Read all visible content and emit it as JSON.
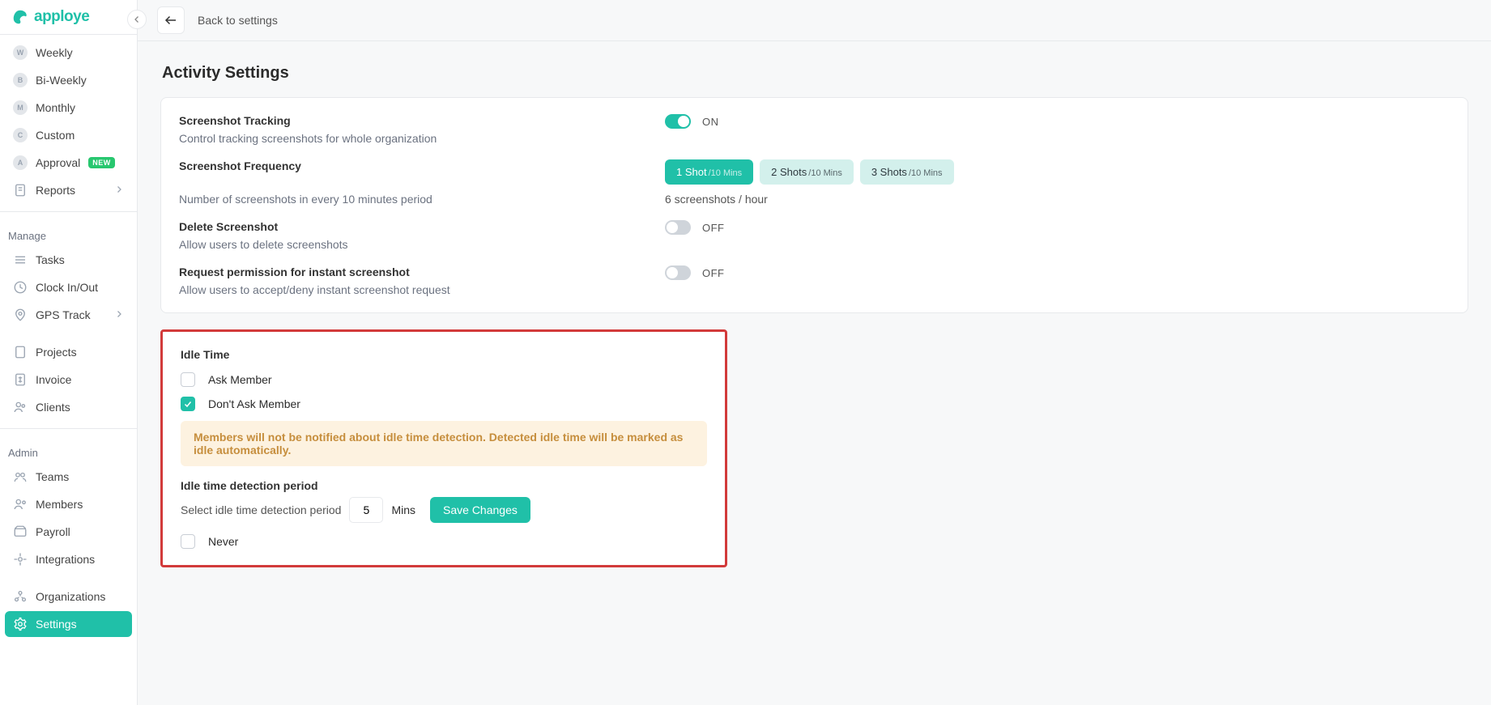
{
  "brand": {
    "name": "apploye"
  },
  "topbar": {
    "back_label": "Back to settings"
  },
  "sidebar": {
    "section_manage": "Manage",
    "section_admin": "Admin",
    "items_top": [
      {
        "letter": "W",
        "label": "Weekly"
      },
      {
        "letter": "B",
        "label": "Bi-Weekly"
      },
      {
        "letter": "M",
        "label": "Monthly"
      },
      {
        "letter": "C",
        "label": "Custom"
      },
      {
        "letter": "A",
        "label": "Approval",
        "badge": "NEW"
      }
    ],
    "reports": "Reports",
    "manage_items": [
      {
        "label": "Tasks"
      },
      {
        "label": "Clock In/Out"
      },
      {
        "label": "GPS Track",
        "chevron": true
      },
      {
        "label": "Projects"
      },
      {
        "label": "Invoice"
      },
      {
        "label": "Clients"
      }
    ],
    "admin_items": [
      {
        "label": "Teams"
      },
      {
        "label": "Members"
      },
      {
        "label": "Payroll"
      },
      {
        "label": "Integrations"
      },
      {
        "label": "Organizations"
      },
      {
        "label": "Settings",
        "active": true
      }
    ]
  },
  "page": {
    "title": "Activity Settings"
  },
  "settings": {
    "tracking": {
      "title": "Screenshot Tracking",
      "desc": "Control tracking screenshots for whole organization",
      "state": "ON"
    },
    "frequency": {
      "title": "Screenshot Frequency",
      "desc": "Number of screenshots in every 10 minutes period",
      "summary": "6 screenshots / hour",
      "options": [
        {
          "main": "1 Shot",
          "sub": "/10 Mins",
          "active": true
        },
        {
          "main": "2 Shots",
          "sub": "/10 Mins"
        },
        {
          "main": "3 Shots",
          "sub": "/10 Mins"
        }
      ]
    },
    "delete": {
      "title": "Delete Screenshot",
      "desc": "Allow users to delete screenshots",
      "state": "OFF"
    },
    "permission": {
      "title": "Request permission for instant screenshot",
      "desc": "Allow users to accept/deny instant screenshot request",
      "state": "OFF"
    }
  },
  "idle": {
    "title": "Idle Time",
    "opt_ask": "Ask Member",
    "opt_dont": "Don't Ask Member",
    "notice": "Members will not be notified about idle time detection. Detected idle time will be marked as idle automatically.",
    "period_title": "Idle time detection period",
    "period_label": "Select idle time detection period",
    "period_value": "5",
    "period_unit": "Mins",
    "save": "Save Changes",
    "never": "Never"
  }
}
